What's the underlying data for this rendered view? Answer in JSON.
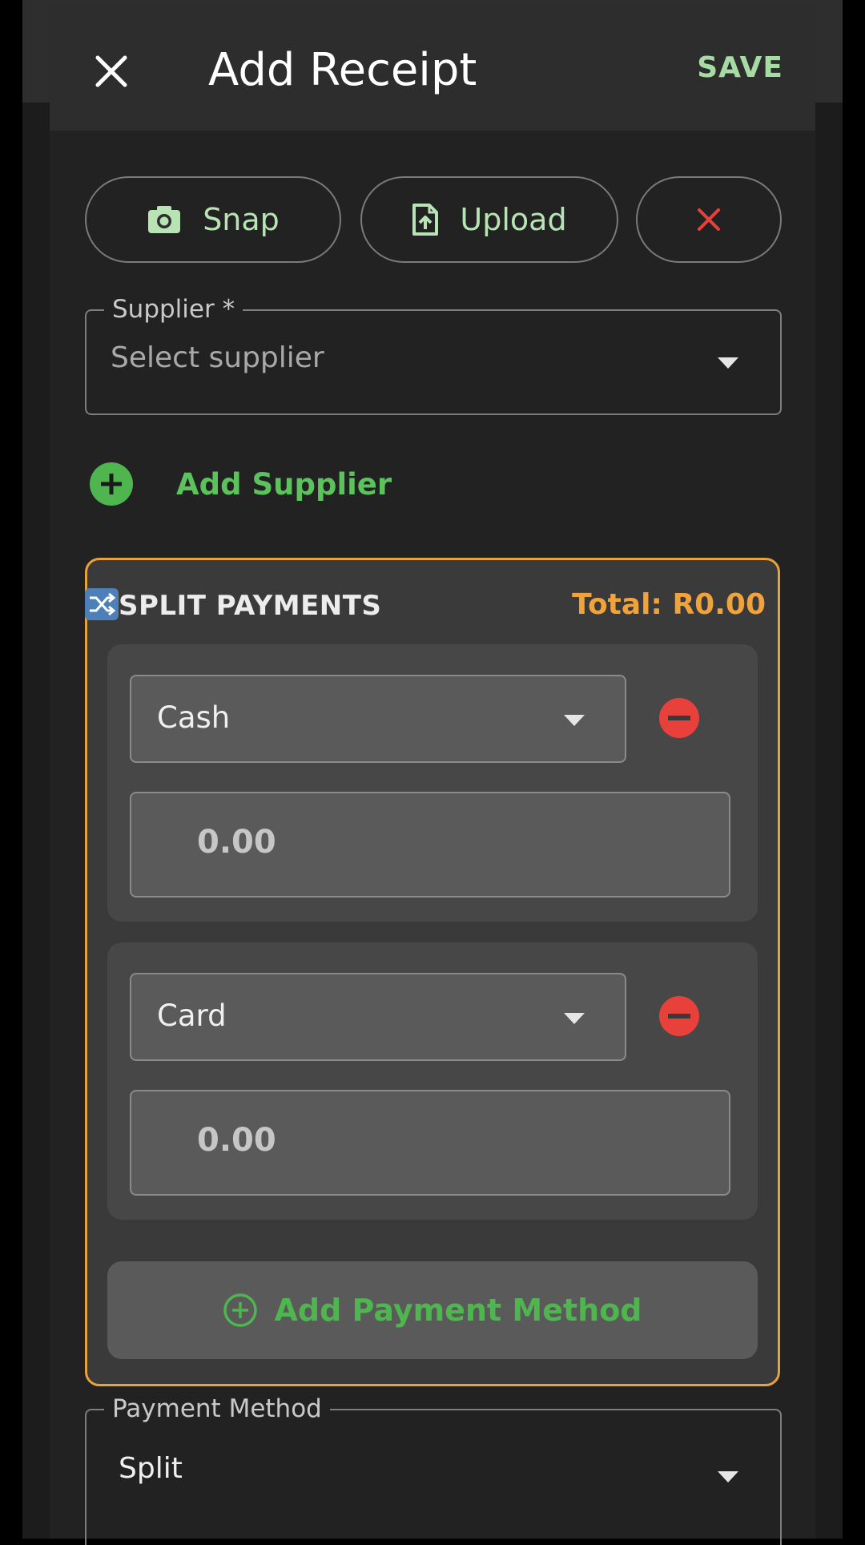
{
  "header": {
    "title": "Add Receipt",
    "save_label": "SAVE",
    "close_icon": "close-icon"
  },
  "attach": {
    "snap_label": "Snap",
    "upload_label": "Upload",
    "snap_icon": "camera-icon",
    "upload_icon": "file-upload-icon",
    "clear_icon": "close-icon"
  },
  "supplier": {
    "label": "Supplier *",
    "placeholder": "Select supplier",
    "add_label": "Add Supplier"
  },
  "split": {
    "title": "SPLIT PAYMENTS",
    "total": "Total: R0.00",
    "items": [
      {
        "method": "Cash",
        "amount": "0.00"
      },
      {
        "method": "Card",
        "amount": "0.00"
      }
    ],
    "add_method_label": "Add Payment Method"
  },
  "payment_method": {
    "label": "Payment Method",
    "value": "Split"
  },
  "colors": {
    "accent_green": "#5cc25c",
    "save_green": "#a6dca4",
    "orange": "#f0a33a",
    "remove_red": "#e8413b"
  }
}
